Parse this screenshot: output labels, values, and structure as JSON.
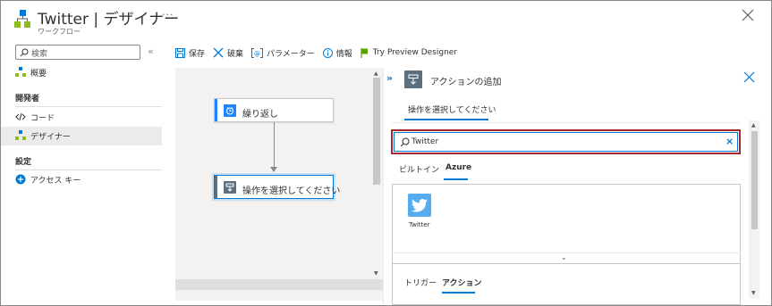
{
  "header": {
    "title": "Twitter | デザイナー",
    "subtitle": "ワークフロー",
    "more": "···"
  },
  "nav": {
    "search_placeholder": "検索",
    "collapse": "«",
    "items": [
      {
        "label": "概要"
      },
      {
        "label": "コード"
      },
      {
        "label": "デザイナー"
      },
      {
        "label": "アクセス キー"
      }
    ],
    "sections": {
      "developer": "開発者",
      "settings": "設定"
    }
  },
  "toolbar": {
    "save": "保存",
    "discard": "破棄",
    "parameters": "パラメーター",
    "info": "情報",
    "preview": "Try Preview Designer"
  },
  "canvas": {
    "recurrence": "繰り返し",
    "choose_action": "操作を選択してください"
  },
  "panel": {
    "expand": "»",
    "title": "アクションの追加",
    "tab": "操作を選択してください",
    "search_value": "Twitter",
    "clear": "×",
    "source_tabs": [
      "ビルトイン",
      "Azure"
    ],
    "result_label": "Twitter",
    "type_tabs": [
      "トリガー",
      "アクション"
    ],
    "chevron": "⌄"
  },
  "colors": {
    "accent": "#0078d4",
    "highlight_box": "#a4262c",
    "twitter": "#55acee"
  }
}
